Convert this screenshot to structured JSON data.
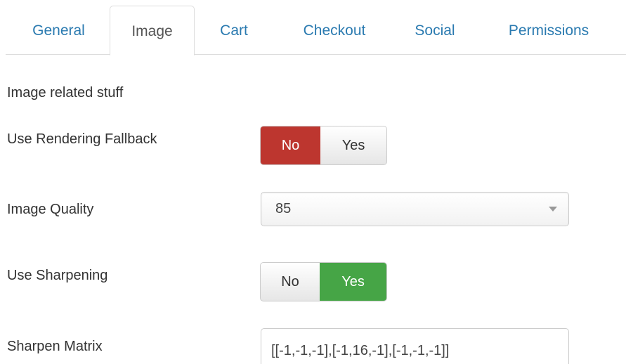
{
  "tabs": [
    {
      "label": "General",
      "active": false
    },
    {
      "label": "Image",
      "active": true
    },
    {
      "label": "Cart",
      "active": false
    },
    {
      "label": "Checkout",
      "active": false
    },
    {
      "label": "Social",
      "active": false
    },
    {
      "label": "Permissions",
      "active": false
    }
  ],
  "form": {
    "description": "Image related stuff",
    "rendering_fallback": {
      "label": "Use Rendering Fallback",
      "no_label": "No",
      "yes_label": "Yes",
      "selected": "No"
    },
    "image_quality": {
      "label": "Image Quality",
      "value": "85"
    },
    "sharpening": {
      "label": "Use Sharpening",
      "no_label": "No",
      "yes_label": "Yes",
      "selected": "Yes"
    },
    "sharpen_matrix": {
      "label": "Sharpen Matrix",
      "value": "[[-1,-1,-1],[-1,16,-1],[-1,-1,-1]]"
    }
  },
  "colors": {
    "tab_link": "#2a7ab0",
    "no_active": "#bd362f",
    "yes_active": "#46a546",
    "border": "#cccccc"
  },
  "icons": {
    "select_caret": "caret-down-icon"
  }
}
